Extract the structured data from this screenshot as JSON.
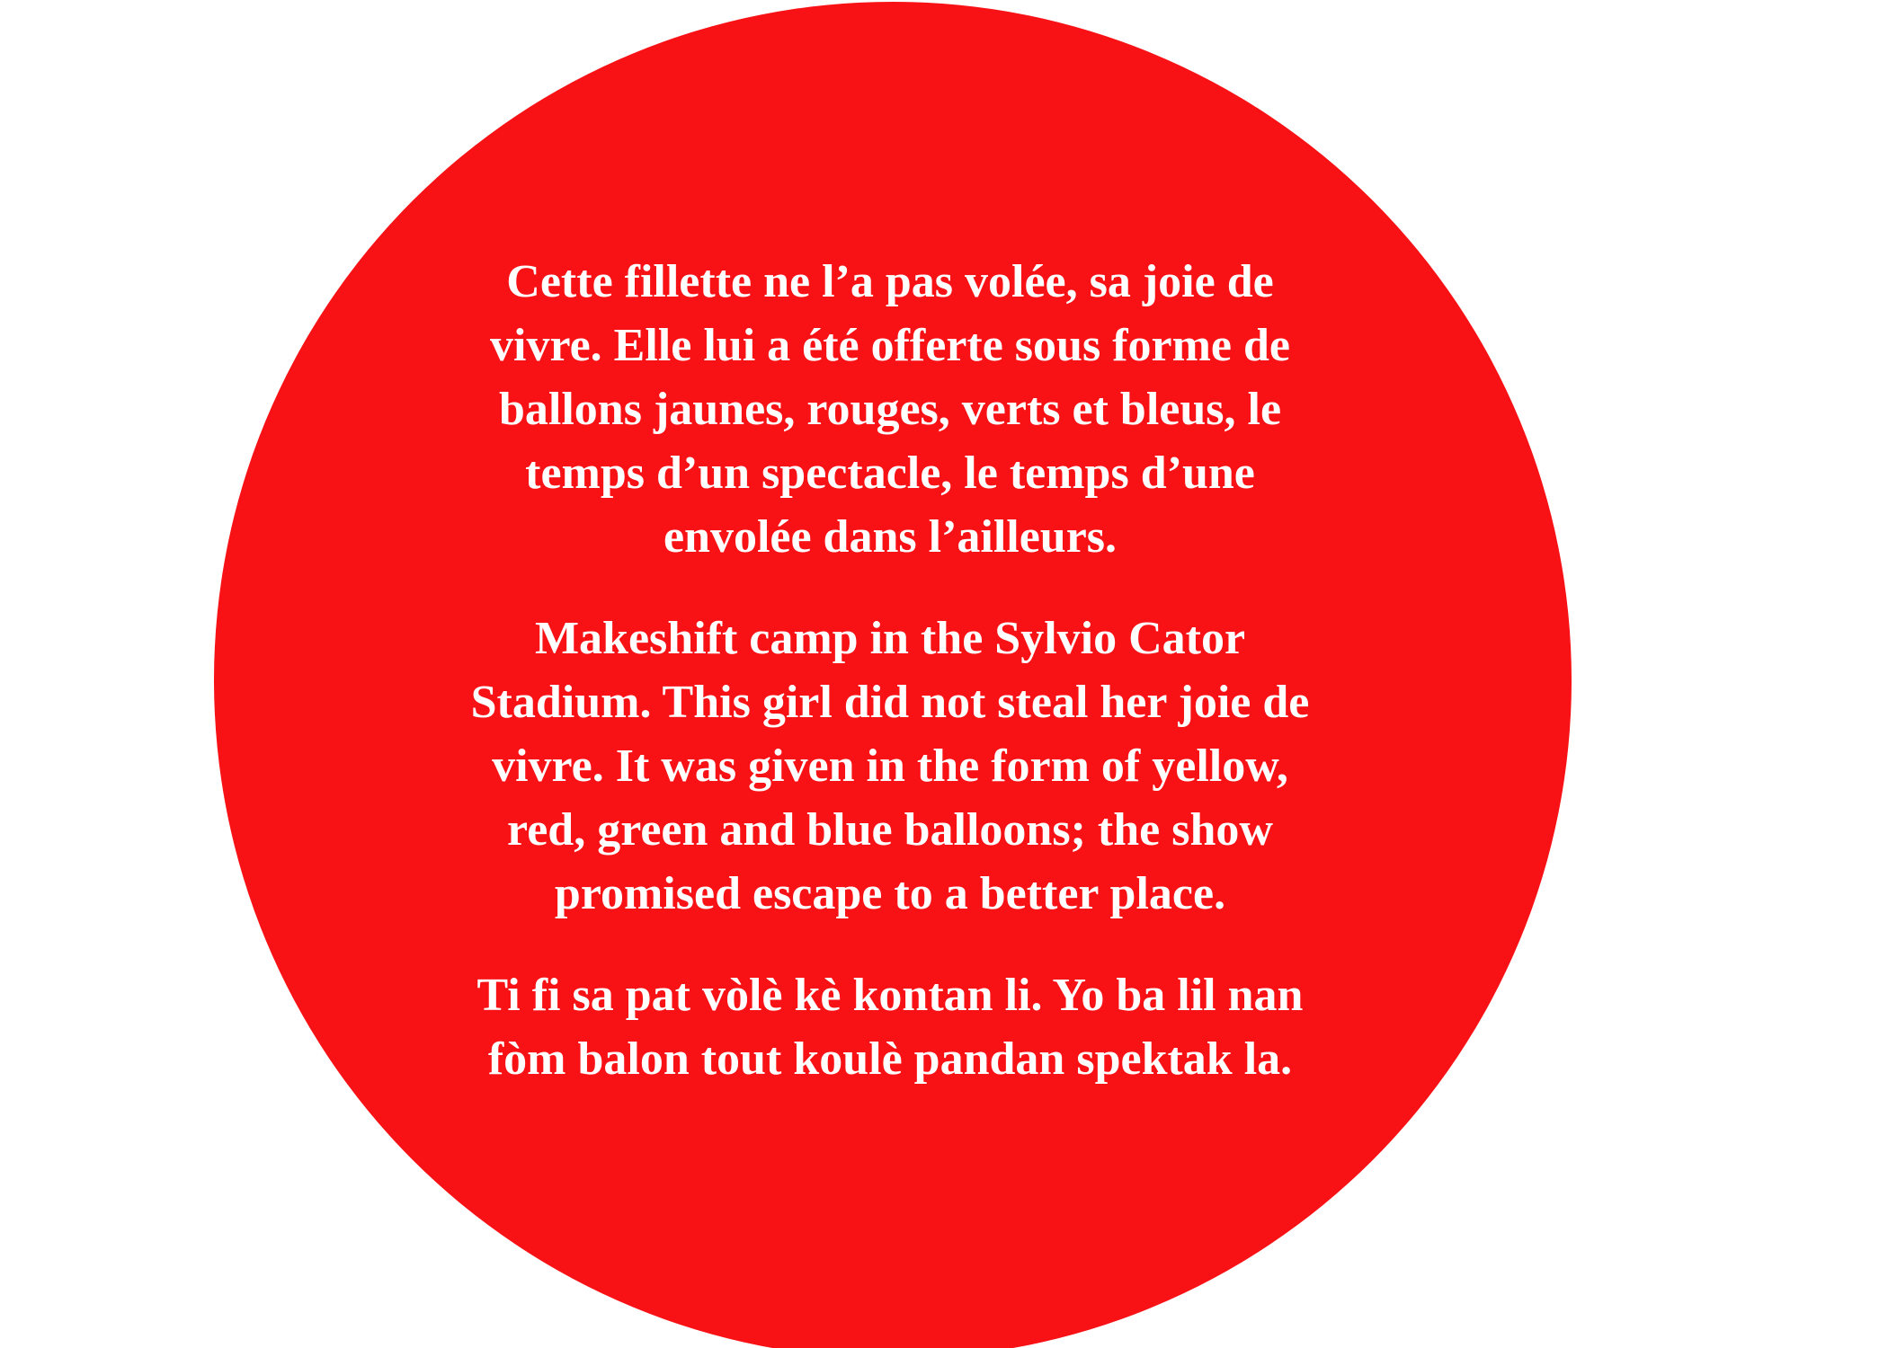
{
  "circle": {
    "color": "#f81115"
  },
  "text_color": "#ffffff",
  "paragraphs": [
    {
      "language": "French",
      "lines": [
        "Cette fillette ne l’a pas volée, sa joie de",
        "vivre. Elle lui a été offerte sous forme de",
        "ballons jaunes, rouges, verts et bleus, le",
        "temps d’un spectacle, le temps d’une",
        "envolée dans l’ailleurs."
      ]
    },
    {
      "language": "English",
      "lines": [
        "Makeshift camp in the Sylvio Cator",
        "Stadium. This girl did not steal her joie de",
        "vivre. It was given in the form of yellow,",
        "red, green and blue balloons; the show",
        "promised escape to a better place."
      ]
    },
    {
      "language": "Haitian Creole",
      "lines": [
        "Ti fi sa pat vòlè kè kontan li. Yo ba lil nan",
        "fòm balon tout koulè pandan spektak la."
      ]
    }
  ]
}
